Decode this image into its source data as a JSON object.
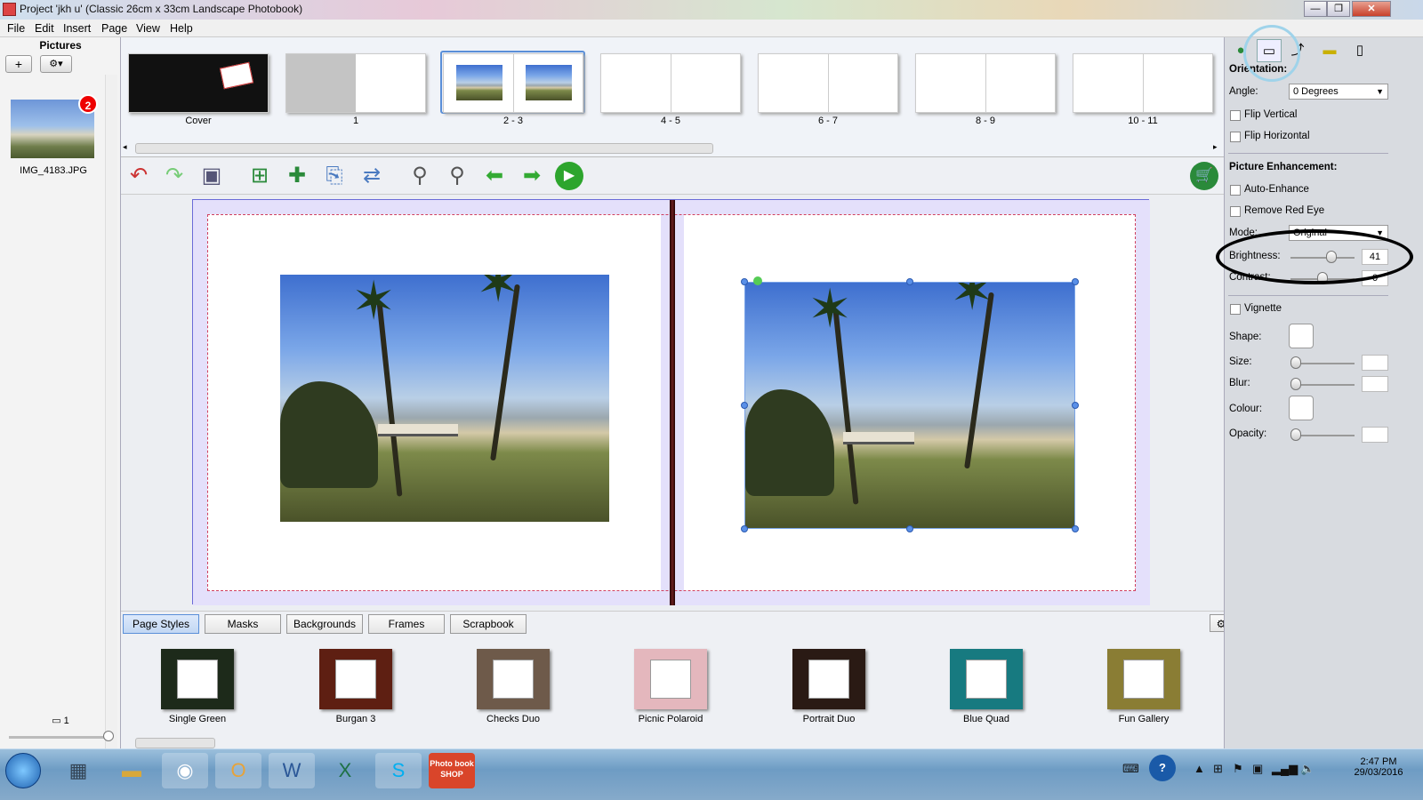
{
  "window": {
    "title": "Project 'jkh u' (Classic 26cm x 33cm Landscape Photobook)",
    "minimize": "—",
    "restore": "❐",
    "close": "✕"
  },
  "menu": [
    "File",
    "Edit",
    "Insert",
    "Page",
    "View",
    "Help"
  ],
  "pictures_panel": {
    "title": "Pictures",
    "add_label": "+",
    "settings_label": "⚙▾",
    "picture_name": "IMG_4183.JPG",
    "picture_badge": "2",
    "page_count": "1"
  },
  "page_strip": {
    "pages": [
      {
        "label": "Cover"
      },
      {
        "label": "1"
      },
      {
        "label": "2 - 3"
      },
      {
        "label": "4 - 5"
      },
      {
        "label": "6 - 7"
      },
      {
        "label": "8 - 9"
      },
      {
        "label": "10 - 11"
      }
    ],
    "selected": "2 - 3"
  },
  "toolbar": {
    "icons": [
      "undo-icon",
      "redo-icon",
      "save-icon",
      "add-picture-icon",
      "add-text-icon",
      "insert-page-icon",
      "page-order-icon",
      "zoom-out-icon",
      "zoom-in-icon",
      "previous-page-icon",
      "next-page-icon",
      "preview-play-icon",
      "cart-icon"
    ]
  },
  "bottom_tabs": [
    "Page Styles",
    "Masks",
    "Backgrounds",
    "Frames",
    "Scrapbook"
  ],
  "page_styles": [
    {
      "label": "Single Green",
      "color": "#1d2a1a"
    },
    {
      "label": "Burgan 3",
      "color": "#5e1f12"
    },
    {
      "label": "Checks Duo",
      "color": "#6e5a4a"
    },
    {
      "label": "Picnic Polaroid",
      "color": "#e4b7bd"
    },
    {
      "label": "Portrait Duo",
      "color": "#2a1a14"
    },
    {
      "label": "Blue Quad",
      "color": "#177a80"
    },
    {
      "label": "Fun Gallery",
      "color": "#8a7d34"
    }
  ],
  "properties": {
    "orientation_label": "Orientation:",
    "angle_label": "Angle:",
    "angle_value": "0 Degrees",
    "flip_vertical": "Flip Vertical",
    "flip_horizontal": "Flip Horizontal",
    "enhancement_label": "Picture Enhancement:",
    "auto_enhance": "Auto-Enhance",
    "remove_red_eye": "Remove Red Eye",
    "mode_label": "Mode:",
    "mode_value": "Original",
    "brightness_label": "Brightness:",
    "brightness_value": "41",
    "contrast_label": "Contrast:",
    "contrast_value": "0",
    "vignette": "Vignette",
    "shape_label": "Shape:",
    "size_label": "Size:",
    "blur_label": "Blur:",
    "colour_label": "Colour:",
    "opacity_label": "Opacity:"
  },
  "taskbar": {
    "apps": [
      "calculator-icon",
      "file-explorer-icon",
      "chrome-icon",
      "outlook-icon",
      "word-icon",
      "excel-icon",
      "skype-icon",
      "photobook-shop-icon"
    ],
    "photobook_label": "Photo book SHOP",
    "time": "2:47 PM",
    "date": "29/03/2016"
  },
  "colors": {
    "accent": "#5a8fd8",
    "bleed_band": "#e4e0fb",
    "safe_line": "#d04060",
    "badge": "#e00000"
  }
}
